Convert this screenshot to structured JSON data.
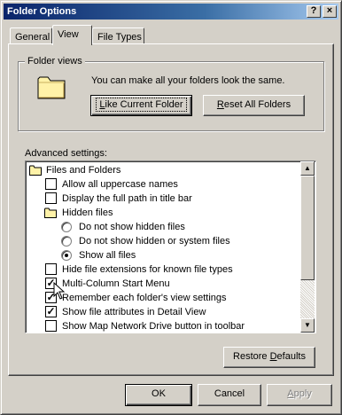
{
  "window": {
    "title": "Folder Options",
    "help_label": "?",
    "close_label": "×"
  },
  "tabs": [
    {
      "label": "General"
    },
    {
      "label": "View"
    },
    {
      "label": "File Types"
    }
  ],
  "folder_views": {
    "label": "Folder views",
    "description": "You can make all your folders look the same.",
    "like_current_prefix": "L",
    "like_current_rest": "ike Current Folder",
    "reset_prefix": "R",
    "reset_rest": "eset All Folders"
  },
  "advanced": {
    "label": "Advanced settings:",
    "items": [
      {
        "type": "folder",
        "label": "Files and Folders"
      },
      {
        "type": "checkbox",
        "checked": false,
        "label": "Allow all uppercase names"
      },
      {
        "type": "checkbox",
        "checked": false,
        "label": "Display the full path in title bar"
      },
      {
        "type": "folder",
        "label": "Hidden files"
      },
      {
        "type": "radio",
        "checked": false,
        "label": "Do not show hidden files"
      },
      {
        "type": "radio",
        "checked": false,
        "label": "Do not show hidden or system files"
      },
      {
        "type": "radio",
        "checked": true,
        "label": "Show all files"
      },
      {
        "type": "checkbox",
        "checked": false,
        "label": "Hide file extensions for known file types"
      },
      {
        "type": "checkbox",
        "checked": true,
        "label": "Multi-Column Start Menu"
      },
      {
        "type": "checkbox",
        "checked": true,
        "label": "Remember each folder's view settings"
      },
      {
        "type": "checkbox",
        "checked": true,
        "label": "Show file attributes in Detail View"
      },
      {
        "type": "checkbox",
        "checked": false,
        "label": "Show Map Network Drive button in toolbar"
      }
    ]
  },
  "restore": {
    "prefix": "Restore ",
    "hot": "D",
    "rest": "efaults"
  },
  "footer": {
    "ok_label": "OK",
    "cancel_label": "Cancel",
    "apply_prefix": "A",
    "apply_rest": "pply"
  }
}
